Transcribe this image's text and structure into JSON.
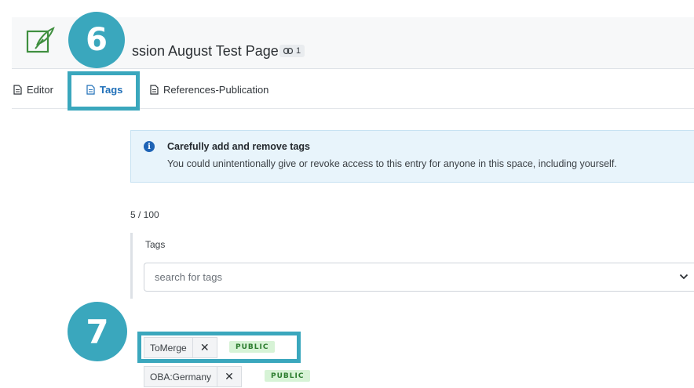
{
  "header": {
    "title": "ssion August Test Page",
    "link_count": "1"
  },
  "tabs": [
    {
      "label": "Editor",
      "active": false
    },
    {
      "label": "Tags",
      "active": true
    },
    {
      "label": "References-Publication",
      "active": false
    }
  ],
  "markers": {
    "tabs_step": "6",
    "tag_step": "7"
  },
  "notice": {
    "title": "Carefully add and remove tags",
    "text": "You could unintentionally give or revoke access to this entry for anyone in this space, including yourself."
  },
  "tags_panel": {
    "count": "5 / 100",
    "label": "Tags",
    "search_placeholder": "search for tags",
    "items": [
      {
        "name": "ToMerge",
        "remove": "✕",
        "visibility": "PUBLIC"
      },
      {
        "name": "OBA:Germany",
        "remove": "✕",
        "visibility": "PUBLIC"
      }
    ]
  },
  "colors": {
    "accent": "#3aa7bd",
    "active_tab": "#1f6fb8",
    "public_badge_bg": "#d7f3d6",
    "public_badge_text": "#2b7b2d",
    "notice_bg": "#e8f4fb"
  }
}
